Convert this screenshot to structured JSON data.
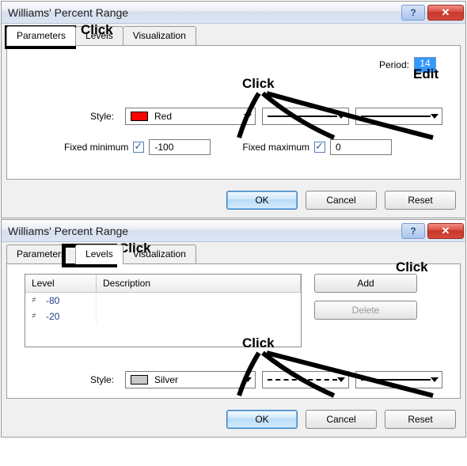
{
  "annotations": {
    "click": "Click",
    "edit": "Edit"
  },
  "dialog1": {
    "title": "Williams' Percent Range",
    "tabs": {
      "parameters": "Parameters",
      "levels": "Levels",
      "visualization": "Visualization"
    },
    "period_label": "Period:",
    "period_value": "14",
    "style_label": "Style:",
    "style_color_name": "Red",
    "style_color_hex": "#ff0000",
    "fixed_min_label": "Fixed minimum",
    "fixed_min_checked": true,
    "fixed_min_value": "-100",
    "fixed_max_label": "Fixed maximum",
    "fixed_max_checked": true,
    "fixed_max_value": "0",
    "buttons": {
      "ok": "OK",
      "cancel": "Cancel",
      "reset": "Reset"
    }
  },
  "dialog2": {
    "title": "Williams' Percent Range",
    "tabs": {
      "parameters": "Parameters",
      "levels": "Levels",
      "visualization": "Visualization"
    },
    "table": {
      "col_level": "Level",
      "col_desc": "Description",
      "rows": [
        {
          "level": "-80",
          "desc": ""
        },
        {
          "level": "-20",
          "desc": ""
        }
      ]
    },
    "add": "Add",
    "delete": "Delete",
    "style_label": "Style:",
    "style_color_name": "Silver",
    "style_color_hex": "#c8c8c8",
    "buttons": {
      "ok": "OK",
      "cancel": "Cancel",
      "reset": "Reset"
    }
  }
}
